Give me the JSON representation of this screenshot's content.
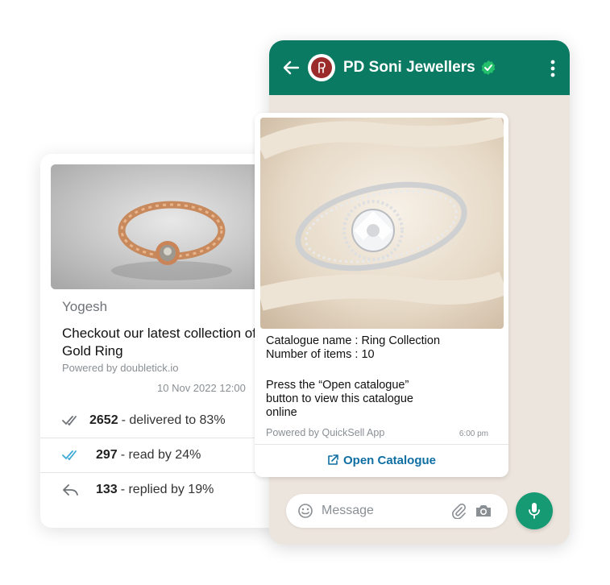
{
  "stats_card": {
    "sender": "Yogesh",
    "headline": "Checkout our latest collection of Gold Ring",
    "powered_by": "Powered by doubletick.io",
    "date": "10 Nov 2022   12:00",
    "stats": [
      {
        "count": "2652",
        "text": " - delivered to 83%",
        "icon": "double-check-icon"
      },
      {
        "count": "297",
        "text": " - read by 24%",
        "icon": "double-check-blue-icon"
      },
      {
        "count": "133",
        "text": " - replied by 19%",
        "icon": "reply-icon"
      }
    ]
  },
  "chat": {
    "contact_name": "PD Soni Jewellers",
    "avatar_monogram": "P",
    "message": {
      "line1": "Catalogue name : Ring Collection",
      "line2": "Number of items : 10",
      "line3": "Press the “Open catalogue” button to view this catalogue online",
      "powered_by": "Powered by QuickSell App",
      "time": "6:00 pm",
      "button_label": "Open Catalogue"
    },
    "input": {
      "placeholder": "Message"
    }
  },
  "colors": {
    "header": "#0b7a62",
    "chat_background": "#ece5dd",
    "mic_button": "#159a73",
    "link": "#0f6fa3",
    "verified": "#25c06b"
  }
}
